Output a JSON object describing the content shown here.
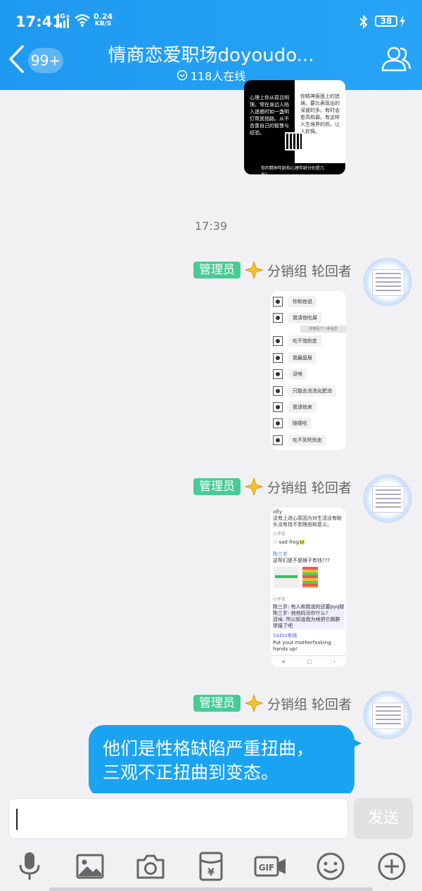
{
  "status_bar": {
    "time": "17:41",
    "network": "4G+",
    "speed_value": "0.24",
    "speed_unit": "KB/S",
    "battery": "38"
  },
  "header": {
    "unread_badge": "99+",
    "title": "情商恋爱职场doyoudo...",
    "online": "118人在线"
  },
  "chat": {
    "card0": {
      "left_text": "心理上你从容且明理。常在身边人陷入迷惑时如一盏明灯帮其指路。从不吝啬自己的智慧与经验。",
      "right_text": "你精神层面上的追境。要比表现出的深邃的多。有时会愈高和寡。有这样人生境界的你。让人钦佩。",
      "footer": "你的精神年龄和心理年龄分别是几岁?"
    },
    "timestamp": "17:39",
    "sender": {
      "role": "管理员",
      "name": "分销组 轮回者"
    },
    "chat_card": {
      "rows": [
        "你和他说",
        "我请他吃屎",
        "吃不饱别走",
        "我最庭居",
        "没啥",
        "只能去洗洗化肥池",
        "我请他来",
        "随便吃",
        "吃不到死别走"
      ],
      "system": "你撤回了一条消息"
    },
    "forum_card": {
      "line1": "ofly",
      "line2": "没有上进心原因为对生活没有盼头没有找不到理由和意义。",
      "reply": "小评论",
      "user1": "♡ sad frog🐸",
      "user2": "陈三岁",
      "question": "这帮们是不是猴子有钱???",
      "reply2": "小评论",
      "q1": "陈三岁: 有人和我说的还要pyq联系?",
      "q2": "陈三岁: 他他妈没你什么?",
      "q3": "百味: 所以知道我为啥把它踢群举报了吧",
      "user3": "SADiz串微",
      "put": "Put your motherfxxking hands up!"
    },
    "bubble_line1": "他们是性格缺陷严重扭曲，",
    "bubble_line2": "三观不正扭曲到变态。"
  },
  "input": {
    "placeholder": "",
    "send_label": "发送"
  },
  "toolbar": {
    "icons": [
      "microphone-icon",
      "image-icon",
      "camera-icon",
      "red-packet-icon",
      "gif-icon",
      "emoji-icon",
      "plus-icon"
    ]
  },
  "colors": {
    "header": "#1e99f0",
    "bubble": "#1aa3f0",
    "role_badge": "#49cb95"
  }
}
